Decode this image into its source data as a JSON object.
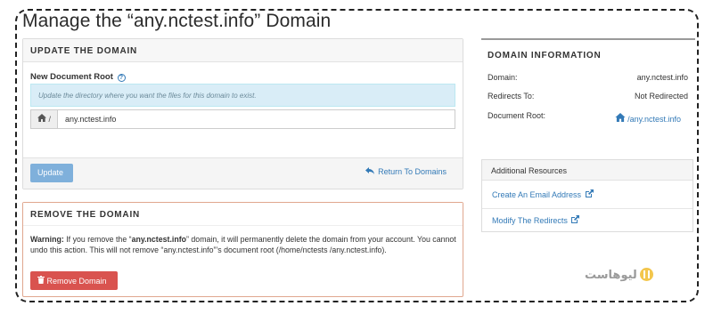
{
  "page": {
    "title": "Manage the “any.nctest.info” Domain"
  },
  "update_panel": {
    "heading": "UPDATE THE DOMAIN",
    "field_label": "New Document Root",
    "help_glyph": "?",
    "hint": "Update the directory where you want the files for this domain to exist.",
    "input_prefix": "/",
    "input_value": "any.nctest.info",
    "update_button": "Update",
    "return_link": "Return To Domains"
  },
  "remove_panel": {
    "heading": "REMOVE THE DOMAIN",
    "warning_label": "Warning:",
    "warning_part1": " If you remove the “",
    "warning_domain": "any.nctest.info",
    "warning_part2": "” domain, it will permanently delete the domain from your account. You cannot undo this action. This will not remove “any.nctest.info”’s document root (/home/nctests /any.nctest.info).",
    "remove_button": "Remove Domain"
  },
  "domain_info": {
    "heading": "DOMAIN INFORMATION",
    "rows": [
      {
        "label": "Domain:",
        "value": "any.nctest.info"
      },
      {
        "label": "Redirects To:",
        "value": "Not Redirected"
      },
      {
        "label": "Document Root:",
        "value": "/any.nctest.info"
      }
    ]
  },
  "resources": {
    "heading": "Additional Resources",
    "items": [
      {
        "label": "Create An Email Address"
      },
      {
        "label": "Modify The Redirects"
      }
    ]
  },
  "logo": {
    "text": "ليوهاست"
  },
  "colors": {
    "accent": "#337ab7",
    "update_button": "#7fb0db",
    "remove_button": "#d9534f",
    "hint_bg": "#d9edf7",
    "remove_border": "#e0a78f"
  },
  "icons": [
    "home-icon",
    "help-icon",
    "return-arrow-icon",
    "trash-icon",
    "external-link-icon"
  ]
}
